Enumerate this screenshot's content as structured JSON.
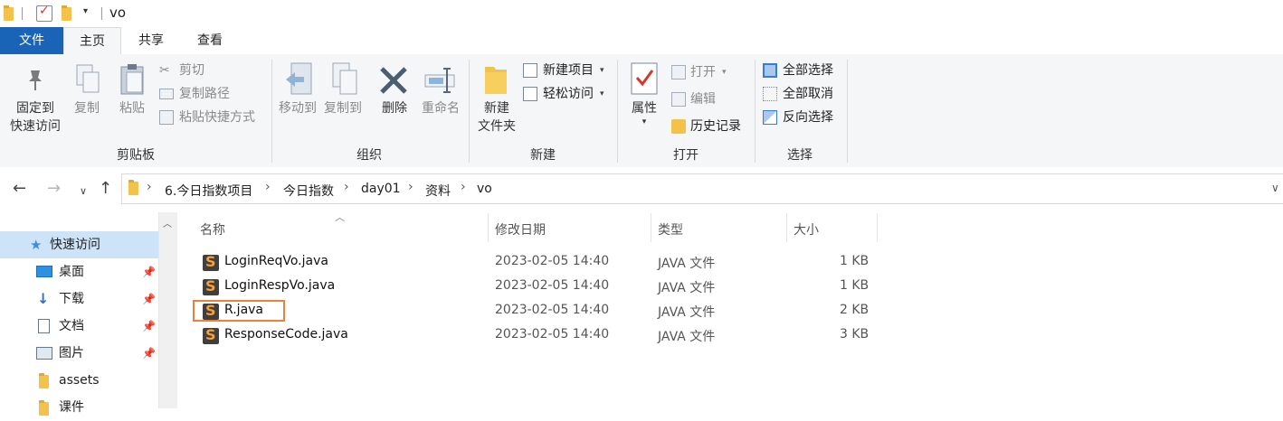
{
  "window": {
    "title": "vo"
  },
  "tabs": [
    {
      "label": "文件"
    },
    {
      "label": "主页"
    },
    {
      "label": "共享"
    },
    {
      "label": "查看"
    }
  ],
  "ribbon": {
    "clipboard": {
      "group_label": "剪贴板",
      "pin_label_line1": "固定到",
      "pin_label_line2": "快速访问",
      "copy_label": "复制",
      "paste_label": "粘贴",
      "cut_label": "剪切",
      "copy_path_label": "复制路径",
      "paste_shortcut_label": "粘贴快捷方式"
    },
    "organize": {
      "group_label": "组织",
      "move_to_label": "移动到",
      "copy_to_label": "复制到",
      "delete_label": "删除",
      "rename_label": "重命名"
    },
    "new": {
      "group_label": "新建",
      "new_folder_line1": "新建",
      "new_folder_line2": "文件夹",
      "new_item_label": "新建项目",
      "easy_access_label": "轻松访问"
    },
    "open": {
      "group_label": "打开",
      "properties_label": "属性",
      "open_label": "打开",
      "edit_label": "编辑",
      "history_label": "历史记录"
    },
    "select": {
      "group_label": "选择",
      "select_all_label": "全部选择",
      "select_none_label": "全部取消",
      "invert_label": "反向选择"
    }
  },
  "breadcrumb": [
    "6.今日指数项目",
    "今日指数",
    "day01",
    "资料",
    "vo"
  ],
  "nav_pane": {
    "items": [
      {
        "label": "快速访问",
        "icon": "star-icon",
        "selected": true
      },
      {
        "label": "桌面",
        "icon": "desktop-icon",
        "pinned": true
      },
      {
        "label": "下载",
        "icon": "download-icon",
        "pinned": true
      },
      {
        "label": "文档",
        "icon": "document-icon",
        "pinned": true
      },
      {
        "label": "图片",
        "icon": "picture-icon",
        "pinned": true
      },
      {
        "label": "assets",
        "icon": "folder-icon"
      },
      {
        "label": "课件",
        "icon": "folder-icon"
      }
    ]
  },
  "file_list": {
    "columns": [
      "名称",
      "修改日期",
      "类型",
      "大小"
    ],
    "files": [
      {
        "name": "LoginReqVo.java",
        "date": "2023-02-05 14:40",
        "type": "JAVA 文件",
        "size": "1 KB"
      },
      {
        "name": "LoginRespVo.java",
        "date": "2023-02-05 14:40",
        "type": "JAVA 文件",
        "size": "1 KB"
      },
      {
        "name": "R.java",
        "date": "2023-02-05 14:40",
        "type": "JAVA 文件",
        "size": "2 KB",
        "highlighted": true
      },
      {
        "name": "ResponseCode.java",
        "date": "2023-02-05 14:40",
        "type": "JAVA 文件",
        "size": "3 KB"
      }
    ]
  },
  "colors": {
    "file_tab": "#1a64b8",
    "ribbon_bg": "#f5f6f7",
    "selection": "#cde3f7",
    "highlight_box": "#ee7f3c",
    "folder": "#f3c24a"
  }
}
